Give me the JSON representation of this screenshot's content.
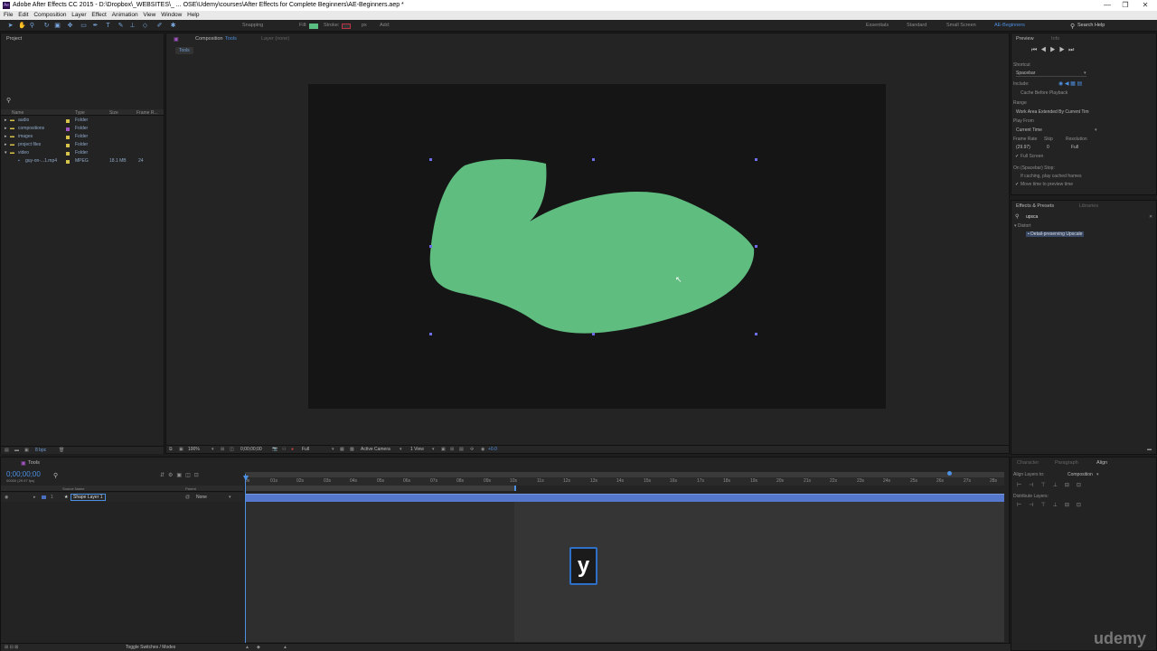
{
  "titlebar": {
    "title": "Adobe After Effects CC 2015 - D:\\Dropbox\\_WEBSITES\\_ ... OSE\\Udemy\\courses\\After Effects for Complete Beginners\\AE-Beginners.aep *",
    "logo": "Ae",
    "minimize": "—",
    "maximize": "❐",
    "close": "✕"
  },
  "menu": [
    "File",
    "Edit",
    "Composition",
    "Layer",
    "Effect",
    "Animation",
    "View",
    "Window",
    "Help"
  ],
  "toolbar": {
    "snapping": "Snapping",
    "fill_label": "Fill:",
    "stroke_label": "Stroke:",
    "stroke_px": "px",
    "add_label": "Add:",
    "workspaces": [
      "Essentials",
      "Standard",
      "Small Screen"
    ],
    "active_workspace": "AE-Beginners",
    "search_help": "Search Help",
    "fill_color": "#5bbf81"
  },
  "project": {
    "tab": "Project",
    "search_placeholder": "",
    "columns": [
      "Name",
      "Type",
      "Size",
      "Frame R..."
    ],
    "items": [
      {
        "name": "audio",
        "type": "Folder",
        "size": "",
        "rate": ""
      },
      {
        "name": "compositions",
        "type": "Folder",
        "size": "",
        "rate": ""
      },
      {
        "name": "images",
        "type": "Folder",
        "size": "",
        "rate": ""
      },
      {
        "name": "project files",
        "type": "Folder",
        "size": "",
        "rate": ""
      },
      {
        "name": "video",
        "type": "Folder",
        "size": "",
        "rate": ""
      },
      {
        "name": "guy-on-...1.mp4",
        "type": "MPEG",
        "size": "18.1 MB",
        "rate": "24"
      }
    ],
    "bpc": "8 bpc"
  },
  "composition": {
    "tab": "Composition",
    "comp_name": "Tools",
    "layer_tab": "Layer (none)",
    "breadcrumb": "Tools",
    "zoom": "100%",
    "timecode": "0;00;00;00",
    "resolution": "Full",
    "camera": "Active Camera",
    "views": "1 View",
    "exposure": "+0.0",
    "shape_color": "#5fbd80"
  },
  "preview": {
    "tabs": [
      "Preview",
      "Info"
    ],
    "shortcut_label": "Shortcut",
    "shortcut_value": "Spacebar",
    "include_label": "Include:",
    "cache_label": "Cache Before Playback",
    "range_label": "Range",
    "range_value": "Work Area Extended By Current Tim",
    "play_from_label": "Play From",
    "play_from_value": "Current Time",
    "frame_rate_label": "Frame Rate",
    "skip_label": "Skip",
    "resolution_label": "Resolution",
    "frame_rate_value": "(29.97)",
    "skip_value": "0",
    "resolution_value": "Full",
    "fullscreen_label": "Full Screen",
    "stop_label": "On (Spacebar) Stop:",
    "stop_opt1": "If caching, play cached frames",
    "stop_opt2": "Move time to preview time"
  },
  "effects": {
    "tabs": [
      "Effects & Presets",
      "Libraries"
    ],
    "search_value": "upsca",
    "category": "Distort",
    "result": "Detail-preserving Upscale"
  },
  "timeline": {
    "tab": "Tools",
    "timecode": "0;00;00;00",
    "subframe": "00000 (29.97 fps)",
    "col_source": "Source Name",
    "col_parent": "Parent",
    "layer_num": "1",
    "layer_name": "Shape Layer 1",
    "parent_value": "None",
    "ruler": [
      "0s",
      "01s",
      "02s",
      "03s",
      "04s",
      "05s",
      "06s",
      "07s",
      "08s",
      "09s",
      "10s",
      "11s",
      "12s",
      "13s",
      "14s",
      "15s",
      "16s",
      "17s",
      "18s",
      "19s",
      "20s",
      "21s",
      "22s",
      "23s",
      "24s",
      "25s",
      "26s",
      "27s",
      "28s"
    ],
    "toggle": "Toggle Switches / Modes",
    "layer_color": "#4a6fbf"
  },
  "align": {
    "tabs": [
      "Character",
      "Paragraph",
      "Align"
    ],
    "align_to_label": "Align Layers to:",
    "align_to_value": "Composition",
    "distribute_label": "Distribute Layers:"
  },
  "keyhint": "y",
  "watermark": "udemy"
}
